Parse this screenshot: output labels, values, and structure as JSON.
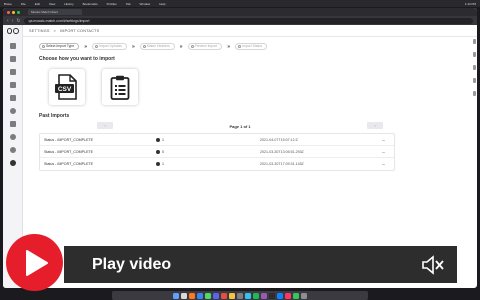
{
  "os_menubar": {
    "items": [
      "Brave",
      "File",
      "Edit",
      "View",
      "History",
      "Bookmarks",
      "Profiles",
      "Tab",
      "Window",
      "Help"
    ],
    "clock": "1:43 PM"
  },
  "browser": {
    "tab_title": "Mosaic Match Client",
    "url": "qa.mosaic-match.com/#/settings/import"
  },
  "breadcrumb": {
    "parent": "SETTINGS",
    "separator": ">",
    "current": "IMPORT CONTACTS"
  },
  "stepper": {
    "steps": [
      {
        "label": "Select Import Type",
        "active": true
      },
      {
        "label": "Import Uploads",
        "active": false
      },
      {
        "label": "Match Headers",
        "active": false
      },
      {
        "label": "Preview Import",
        "active": false
      },
      {
        "label": "Import Status",
        "active": false
      }
    ],
    "separator": "»"
  },
  "choose": {
    "heading": "Choose how you want to import",
    "options": [
      {
        "name": "csv",
        "text": "CSV"
      },
      {
        "name": "clipboard",
        "text": ""
      }
    ]
  },
  "past_imports": {
    "heading": "Past Imports",
    "pagination": {
      "prev": "‹",
      "next": "›",
      "text": "Page 1 of 1"
    },
    "rows": [
      {
        "status": "Status - IMPORT_COMPLETE",
        "user_count": "1",
        "date": "2021-04-07T15:07:12:Z",
        "more": "..."
      },
      {
        "status": "Status - IMPORT_COMPLETE",
        "user_count": "0",
        "date": "2021-03-30T13:05:51.293Z",
        "more": "..."
      },
      {
        "status": "Status - IMPORT_COMPLETE",
        "user_count": "1",
        "date": "2021-03-30T17:09:31.145Z",
        "more": "..."
      }
    ]
  },
  "video_overlay": {
    "label": "Play video",
    "accent_color": "#e61e2b",
    "bar_color": "#2d2d2d",
    "icons": [
      "play-icon",
      "speaker-muted-icon"
    ]
  },
  "help_bubble": {
    "text": "?"
  }
}
